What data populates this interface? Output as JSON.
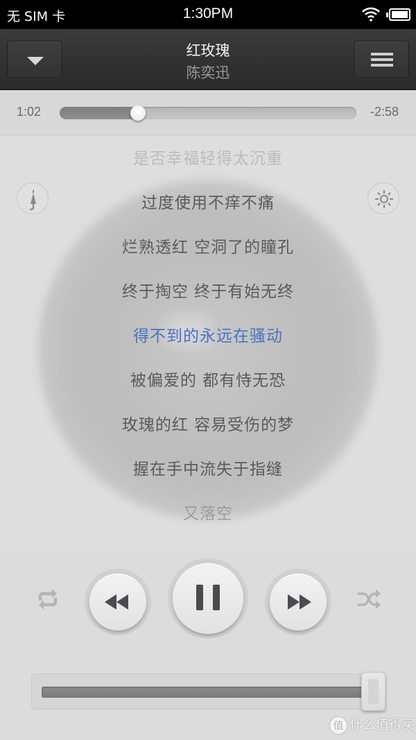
{
  "status_bar": {
    "carrier": "无 SIM 卡",
    "time": "1:30PM",
    "wifi_icon": "wifi-icon",
    "battery_icon": "battery-icon"
  },
  "header": {
    "collapse_icon": "chevron-down-icon",
    "menu_icon": "menu-icon",
    "title": "红玫瑰",
    "artist": "陈奕迅"
  },
  "progress": {
    "elapsed": "1:02",
    "remaining": "-2:58",
    "fraction": 0.263
  },
  "lyrics_panel": {
    "left_icon": "umbrella-icon",
    "right_icon": "brightness-icon",
    "lines": [
      {
        "text": "是否幸福轻得太沉重",
        "state": "faded"
      },
      {
        "text": "过度使用不痒不痛",
        "state": "normal"
      },
      {
        "text": "烂熟透红 空洞了的瞳孔",
        "state": "normal"
      },
      {
        "text": "终于掏空 终于有始无终",
        "state": "normal"
      },
      {
        "text": "得不到的永远在骚动",
        "state": "current"
      },
      {
        "text": "被偏爱的 都有恃无恐",
        "state": "normal"
      },
      {
        "text": "玫瑰的红 容易受伤的梦",
        "state": "normal"
      },
      {
        "text": "握在手中流失于指缝",
        "state": "normal"
      },
      {
        "text": "又落空",
        "state": "fade2"
      }
    ],
    "current_color": "#4a72c4"
  },
  "controls": {
    "repeat_icon": "repeat-icon",
    "previous_icon": "rewind-icon",
    "play_pause_icon": "pause-icon",
    "next_icon": "fast-forward-icon",
    "shuffle_icon": "shuffle-icon"
  },
  "volume": {
    "level": 1.0
  },
  "watermark": {
    "badge": "值",
    "text": "什么值得买"
  }
}
